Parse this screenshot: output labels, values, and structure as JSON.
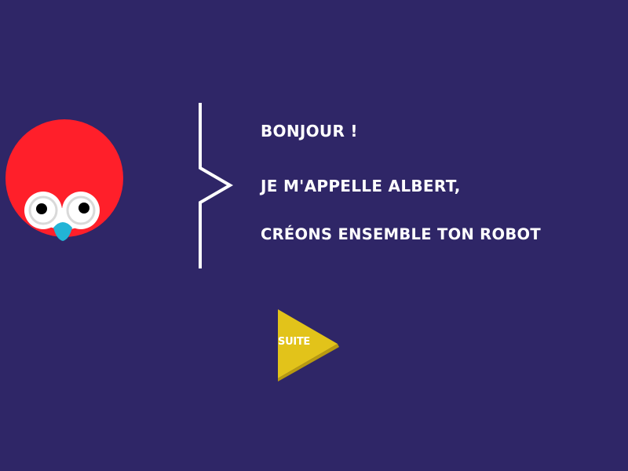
{
  "intro": {
    "line1": "BONJOUR !",
    "line2": "JE M'APPELLE ALBERT,",
    "line3": "CRÉONS ENSEMBLE TON ROBOT"
  },
  "next_button": {
    "label": "SUITE"
  },
  "mascot": {
    "name": "Albert",
    "icon": "robot-mascot-icon"
  },
  "colors": {
    "background": "#2f2667",
    "mascot_head": "#ff1f2a",
    "mascot_face": "#ffffff",
    "mascot_beak": "#22b4d6",
    "button": "#e2c31a",
    "text": "#ffffff"
  }
}
